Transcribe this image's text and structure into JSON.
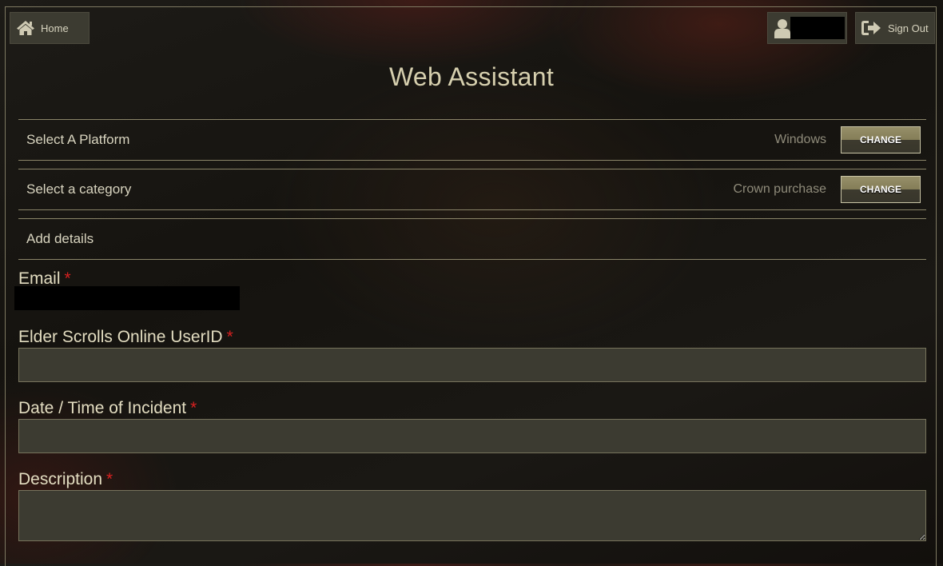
{
  "header": {
    "home_label": "Home",
    "signout_label": "Sign Out",
    "home_icon": "home-icon",
    "user_icon": "user-icon",
    "signout_icon": "sign-out-icon"
  },
  "title": "Web Assistant",
  "steps": [
    {
      "label": "Select A Platform",
      "value": "Windows",
      "button": "CHANGE"
    },
    {
      "label": "Select a category",
      "value": "Crown purchase",
      "button": "CHANGE"
    },
    {
      "label": "Add details"
    }
  ],
  "form": {
    "required_mark": "*",
    "email_label": "Email",
    "userid_label": "Elder Scrolls Online UserID",
    "userid_value": "",
    "date_label": "Date / Time of Incident",
    "date_value": "",
    "description_label": "Description",
    "description_value": ""
  },
  "colors": {
    "accent": "#d6cfae",
    "required": "#d62020",
    "field_bg": "#3c3b31"
  }
}
